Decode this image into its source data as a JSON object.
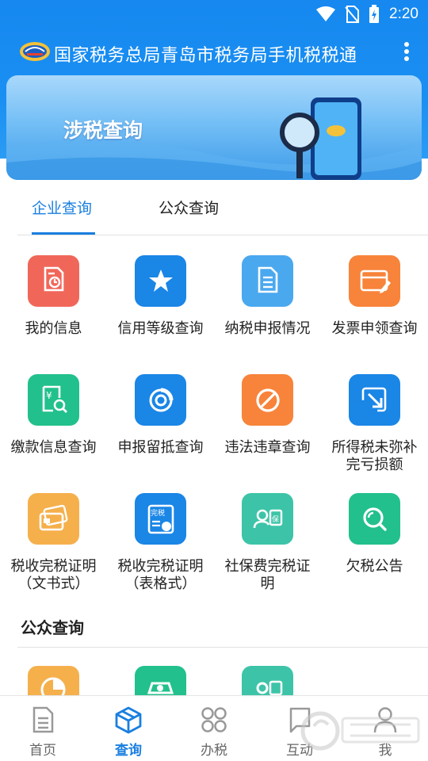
{
  "status_bar": {
    "time": "2:20"
  },
  "app_bar": {
    "title": "国家税务总局青岛市税务局手机税税通"
  },
  "banner": {
    "title": "涉税查询"
  },
  "tabs": [
    {
      "label": "企业查询",
      "active": true
    },
    {
      "label": "公众查询",
      "active": false
    }
  ],
  "enterprise_items": [
    {
      "label": "我的信息",
      "icon": "calendar-doc-icon",
      "color": "#f0675a"
    },
    {
      "label": "信用等级查询",
      "icon": "star-icon",
      "color": "#1a86e6"
    },
    {
      "label": "纳税申报情况",
      "icon": "document-list-icon",
      "color": "#4aa8ef"
    },
    {
      "label": "发票申领查询",
      "icon": "invoice-pen-icon",
      "color": "#f7843a"
    },
    {
      "label": "缴款信息查询",
      "icon": "yuan-search-icon",
      "color": "#22c08c"
    },
    {
      "label": "申报留抵查询",
      "icon": "pie-chart-icon",
      "color": "#1a86e6"
    },
    {
      "label": "违法违章查询",
      "icon": "prohibited-icon",
      "color": "#f7843a"
    },
    {
      "label": "所得税未弥补完亏损额",
      "icon": "arrow-down-right-icon",
      "color": "#1a86e6"
    },
    {
      "label": "税收完税证明（文书式）",
      "icon": "card-stack-icon",
      "color": "#f5b04c"
    },
    {
      "label": "税收完税证明（表格式）",
      "icon": "certificate-user-icon",
      "color": "#1a86e6"
    },
    {
      "label": "社保费完税证明",
      "icon": "user-badge-icon",
      "color": "#3dc4a8"
    },
    {
      "label": "欠税公告",
      "icon": "search-icon",
      "color": "#22c08c"
    }
  ],
  "enterprise_item_lines": [
    [
      "我的信息"
    ],
    [
      "信用等级查询"
    ],
    [
      "纳税申报情况"
    ],
    [
      "发票申领查询"
    ],
    [
      "缴款信息查询"
    ],
    [
      "申报留抵查询"
    ],
    [
      "违法违章查询"
    ],
    [
      "所得税未弥补",
      "完亏损额"
    ],
    [
      "税收完税证明",
      "（文书式）"
    ],
    [
      "税收完税证明",
      "（表格式）"
    ],
    [
      "社保费完税证",
      "明"
    ],
    [
      "欠税公告"
    ]
  ],
  "public_section": {
    "title": "公众查询"
  },
  "public_items_peek": [
    {
      "icon": "pie-chart-icon",
      "color": "#f5b04c"
    },
    {
      "icon": "car-icon",
      "color": "#22c08c"
    },
    {
      "icon": "user-badge-icon",
      "color": "#3dc4a8"
    }
  ],
  "bottom_nav": [
    {
      "label": "首页",
      "icon": "home-doc-icon",
      "active": false
    },
    {
      "label": "查询",
      "icon": "cube-icon",
      "active": true
    },
    {
      "label": "办税",
      "icon": "grid-icon",
      "active": false
    },
    {
      "label": "互动",
      "icon": "chat-icon",
      "active": false
    },
    {
      "label": "我",
      "icon": "user-icon",
      "active": false
    }
  ],
  "colors": {
    "primary": "#1a7fe0",
    "app_bar": "#1688f0"
  }
}
